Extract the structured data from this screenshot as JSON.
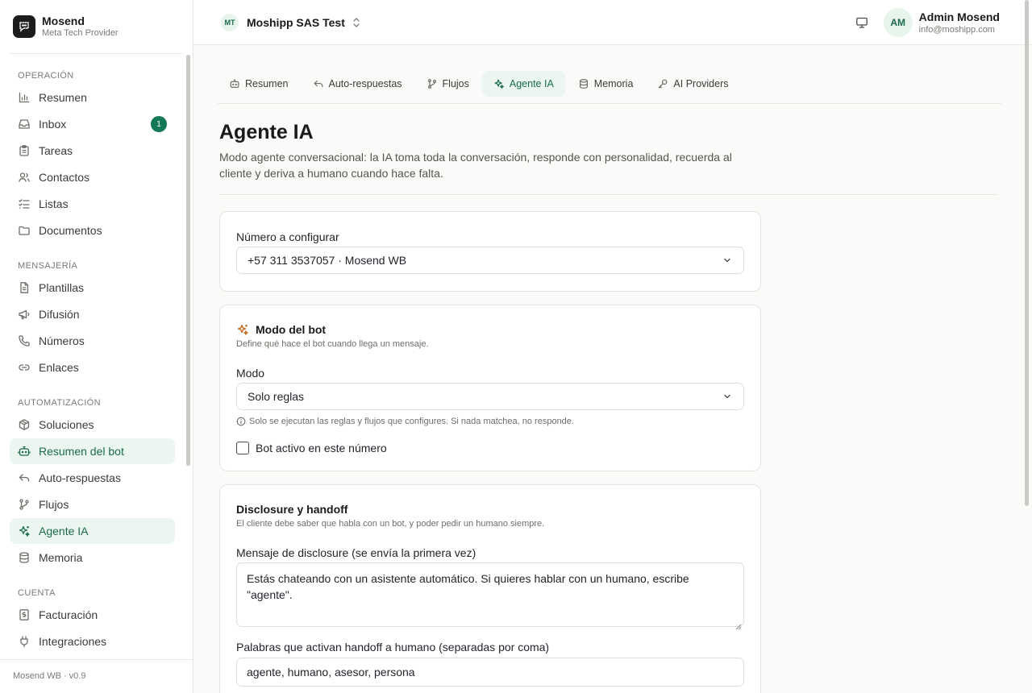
{
  "brand": {
    "name": "Mosend",
    "sub": "Meta Tech Provider"
  },
  "sidebar": {
    "sections": [
      {
        "title": "OPERACIÓN",
        "items": [
          {
            "label": "Resumen",
            "icon": "bar-chart-icon"
          },
          {
            "label": "Inbox",
            "icon": "inbox-icon",
            "badge": "1"
          },
          {
            "label": "Tareas",
            "icon": "clipboard-icon"
          },
          {
            "label": "Contactos",
            "icon": "users-icon"
          },
          {
            "label": "Listas",
            "icon": "list-checks-icon"
          },
          {
            "label": "Documentos",
            "icon": "folder-icon"
          }
        ]
      },
      {
        "title": "MENSAJERÍA",
        "items": [
          {
            "label": "Plantillas",
            "icon": "file-text-icon"
          },
          {
            "label": "Difusión",
            "icon": "megaphone-icon"
          },
          {
            "label": "Números",
            "icon": "phone-icon"
          },
          {
            "label": "Enlaces",
            "icon": "link-icon"
          }
        ]
      },
      {
        "title": "AUTOMATIZACIÓN",
        "items": [
          {
            "label": "Soluciones",
            "icon": "package-icon"
          },
          {
            "label": "Resumen del bot",
            "icon": "bot-icon",
            "active": true
          },
          {
            "label": "Auto-respuestas",
            "icon": "reply-icon"
          },
          {
            "label": "Flujos",
            "icon": "git-branch-icon"
          },
          {
            "label": "Agente IA",
            "icon": "sparkles-icon",
            "active": true
          },
          {
            "label": "Memoria",
            "icon": "database-icon"
          }
        ]
      },
      {
        "title": "CUENTA",
        "items": [
          {
            "label": "Facturación",
            "icon": "receipt-icon"
          },
          {
            "label": "Integraciones",
            "icon": "plug-icon"
          }
        ]
      }
    ],
    "footer": "Mosend WB · v0.9"
  },
  "topbar": {
    "workspace": {
      "initials": "MT",
      "name": "Moshipp SAS Test"
    },
    "user": {
      "initials": "AM",
      "name": "Admin Mosend",
      "email": "info@moshipp.com"
    }
  },
  "tabs": [
    {
      "label": "Resumen",
      "icon": "bot-icon"
    },
    {
      "label": "Auto-respuestas",
      "icon": "reply-icon"
    },
    {
      "label": "Flujos",
      "icon": "git-branch-icon"
    },
    {
      "label": "Agente IA",
      "icon": "sparkles-icon",
      "active": true
    },
    {
      "label": "Memoria",
      "icon": "database-icon"
    },
    {
      "label": "AI Providers",
      "icon": "key-icon"
    }
  ],
  "page": {
    "title": "Agente IA",
    "description": "Modo agente conversacional: la IA toma toda la conversación, responde con personalidad, recuerda al cliente y deriva a humano cuando hace falta."
  },
  "number_card": {
    "label": "Número a configurar",
    "selected": "+57 311 3537057 · Mosend WB"
  },
  "mode_card": {
    "title": "Modo del bot",
    "subtitle": "Define qué hace el bot cuando llega un mensaje.",
    "mode_label": "Modo",
    "mode_selected": "Solo reglas",
    "hint": "Solo se ejecutan las reglas y flujos que configures. Si nada matchea, no responde.",
    "active_label": "Bot activo en este número"
  },
  "disclosure_card": {
    "title": "Disclosure y handoff",
    "subtitle": "El cliente debe saber que habla con un bot, y poder pedir un humano siempre.",
    "message_label": "Mensaje de disclosure (se envía la primera vez)",
    "message_value": "Estás chateando con un asistente automático. Si quieres hablar con un humano, escribe \"agente\".",
    "keywords_label": "Palabras que activan handoff a humano (separadas por coma)",
    "keywords_value": "agente, humano, asesor, persona"
  },
  "colors": {
    "accent": "#1d6b4c",
    "accent_bg": "#eaf6ef",
    "badge": "#137a55",
    "sparkle": "#c46a1f"
  }
}
